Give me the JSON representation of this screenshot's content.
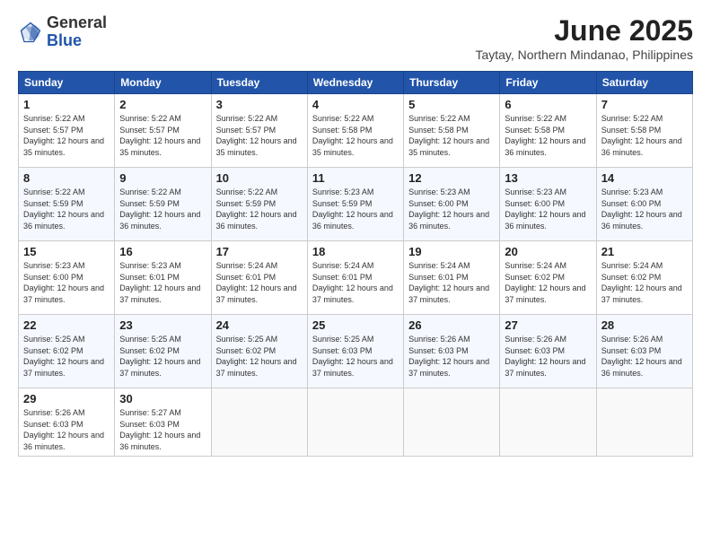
{
  "header": {
    "logo_general": "General",
    "logo_blue": "Blue",
    "month_year": "June 2025",
    "location": "Taytay, Northern Mindanao, Philippines"
  },
  "days_of_week": [
    "Sunday",
    "Monday",
    "Tuesday",
    "Wednesday",
    "Thursday",
    "Friday",
    "Saturday"
  ],
  "weeks": [
    [
      {
        "day": "1",
        "sunrise": "5:22 AM",
        "sunset": "5:57 PM",
        "daylight": "12 hours and 35 minutes"
      },
      {
        "day": "2",
        "sunrise": "5:22 AM",
        "sunset": "5:57 PM",
        "daylight": "12 hours and 35 minutes"
      },
      {
        "day": "3",
        "sunrise": "5:22 AM",
        "sunset": "5:57 PM",
        "daylight": "12 hours and 35 minutes"
      },
      {
        "day": "4",
        "sunrise": "5:22 AM",
        "sunset": "5:58 PM",
        "daylight": "12 hours and 35 minutes"
      },
      {
        "day": "5",
        "sunrise": "5:22 AM",
        "sunset": "5:58 PM",
        "daylight": "12 hours and 35 minutes"
      },
      {
        "day": "6",
        "sunrise": "5:22 AM",
        "sunset": "5:58 PM",
        "daylight": "12 hours and 36 minutes"
      },
      {
        "day": "7",
        "sunrise": "5:22 AM",
        "sunset": "5:58 PM",
        "daylight": "12 hours and 36 minutes"
      }
    ],
    [
      {
        "day": "8",
        "sunrise": "5:22 AM",
        "sunset": "5:59 PM",
        "daylight": "12 hours and 36 minutes"
      },
      {
        "day": "9",
        "sunrise": "5:22 AM",
        "sunset": "5:59 PM",
        "daylight": "12 hours and 36 minutes"
      },
      {
        "day": "10",
        "sunrise": "5:22 AM",
        "sunset": "5:59 PM",
        "daylight": "12 hours and 36 minutes"
      },
      {
        "day": "11",
        "sunrise": "5:23 AM",
        "sunset": "5:59 PM",
        "daylight": "12 hours and 36 minutes"
      },
      {
        "day": "12",
        "sunrise": "5:23 AM",
        "sunset": "6:00 PM",
        "daylight": "12 hours and 36 minutes"
      },
      {
        "day": "13",
        "sunrise": "5:23 AM",
        "sunset": "6:00 PM",
        "daylight": "12 hours and 36 minutes"
      },
      {
        "day": "14",
        "sunrise": "5:23 AM",
        "sunset": "6:00 PM",
        "daylight": "12 hours and 36 minutes"
      }
    ],
    [
      {
        "day": "15",
        "sunrise": "5:23 AM",
        "sunset": "6:00 PM",
        "daylight": "12 hours and 37 minutes"
      },
      {
        "day": "16",
        "sunrise": "5:23 AM",
        "sunset": "6:01 PM",
        "daylight": "12 hours and 37 minutes"
      },
      {
        "day": "17",
        "sunrise": "5:24 AM",
        "sunset": "6:01 PM",
        "daylight": "12 hours and 37 minutes"
      },
      {
        "day": "18",
        "sunrise": "5:24 AM",
        "sunset": "6:01 PM",
        "daylight": "12 hours and 37 minutes"
      },
      {
        "day": "19",
        "sunrise": "5:24 AM",
        "sunset": "6:01 PM",
        "daylight": "12 hours and 37 minutes"
      },
      {
        "day": "20",
        "sunrise": "5:24 AM",
        "sunset": "6:02 PM",
        "daylight": "12 hours and 37 minutes"
      },
      {
        "day": "21",
        "sunrise": "5:24 AM",
        "sunset": "6:02 PM",
        "daylight": "12 hours and 37 minutes"
      }
    ],
    [
      {
        "day": "22",
        "sunrise": "5:25 AM",
        "sunset": "6:02 PM",
        "daylight": "12 hours and 37 minutes"
      },
      {
        "day": "23",
        "sunrise": "5:25 AM",
        "sunset": "6:02 PM",
        "daylight": "12 hours and 37 minutes"
      },
      {
        "day": "24",
        "sunrise": "5:25 AM",
        "sunset": "6:02 PM",
        "daylight": "12 hours and 37 minutes"
      },
      {
        "day": "25",
        "sunrise": "5:25 AM",
        "sunset": "6:03 PM",
        "daylight": "12 hours and 37 minutes"
      },
      {
        "day": "26",
        "sunrise": "5:26 AM",
        "sunset": "6:03 PM",
        "daylight": "12 hours and 37 minutes"
      },
      {
        "day": "27",
        "sunrise": "5:26 AM",
        "sunset": "6:03 PM",
        "daylight": "12 hours and 37 minutes"
      },
      {
        "day": "28",
        "sunrise": "5:26 AM",
        "sunset": "6:03 PM",
        "daylight": "12 hours and 36 minutes"
      }
    ],
    [
      {
        "day": "29",
        "sunrise": "5:26 AM",
        "sunset": "6:03 PM",
        "daylight": "12 hours and 36 minutes"
      },
      {
        "day": "30",
        "sunrise": "5:27 AM",
        "sunset": "6:03 PM",
        "daylight": "12 hours and 36 minutes"
      },
      null,
      null,
      null,
      null,
      null
    ]
  ]
}
